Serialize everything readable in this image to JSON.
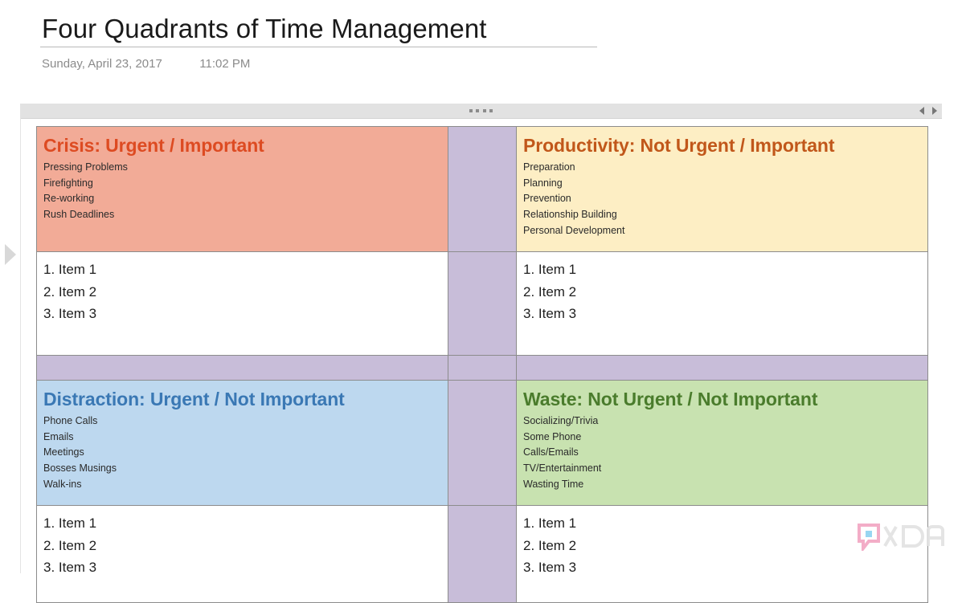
{
  "document": {
    "title": "Four Quadrants of Time Management",
    "date": "Sunday, April 23, 2017",
    "time": "11:02 PM"
  },
  "toolbar": {
    "grip_icon": "grip-dots-icon",
    "prev_icon": "triangle-left-icon",
    "next_icon": "triangle-right-icon"
  },
  "page_nav": {
    "next_page_icon": "chevron-right-icon"
  },
  "colors": {
    "crisis_bg": "#f2ab97",
    "crisis_title": "#dd4b22",
    "productivity_bg": "#fdeec4",
    "productivity_title": "#c1571a",
    "distraction_bg": "#bdd8ef",
    "distraction_title": "#3a78b4",
    "waste_bg": "#c8e2b0",
    "waste_title": "#4a7c2c",
    "divider": "#c8bdd9",
    "cell_border": "#8c8c8c",
    "toolbar_bg": "#e2e2e2"
  },
  "quadrants": {
    "crisis": {
      "title": "Crisis: Urgent / Important",
      "items": [
        "Pressing Problems",
        "Firefighting",
        "Re-working",
        "Rush Deadlines"
      ]
    },
    "productivity": {
      "title": "Productivity: Not Urgent / Important",
      "items": [
        "Preparation",
        "Planning",
        "Prevention",
        "Relationship Building",
        "Personal Development"
      ]
    },
    "distraction": {
      "title": "Distraction: Urgent / Not Important",
      "items": [
        "Phone Calls",
        "Emails",
        "Meetings",
        "Bosses Musings",
        "Walk-ins"
      ]
    },
    "waste": {
      "title": "Waste: Not Urgent / Not Important",
      "items": [
        "Socializing/Trivia",
        "Some Phone",
        "Calls/Emails",
        "TV/Entertainment",
        "Wasting Time"
      ]
    }
  },
  "numbered_lists": {
    "crisis_top": [
      "1. Item 1",
      "2. Item 2",
      "3. Item 3"
    ],
    "productivity_top": [
      "1. Item 1",
      "2. Item 2",
      "3. Item 3"
    ],
    "distraction_bottom": [
      "1. Item 1",
      "2. Item 2",
      "3. Item 3"
    ],
    "waste_bottom": [
      "1. Item 1",
      "2. Item 2",
      "3. Item 3"
    ]
  },
  "watermark": {
    "label": "XDA",
    "icon": "xda-logo-icon"
  }
}
